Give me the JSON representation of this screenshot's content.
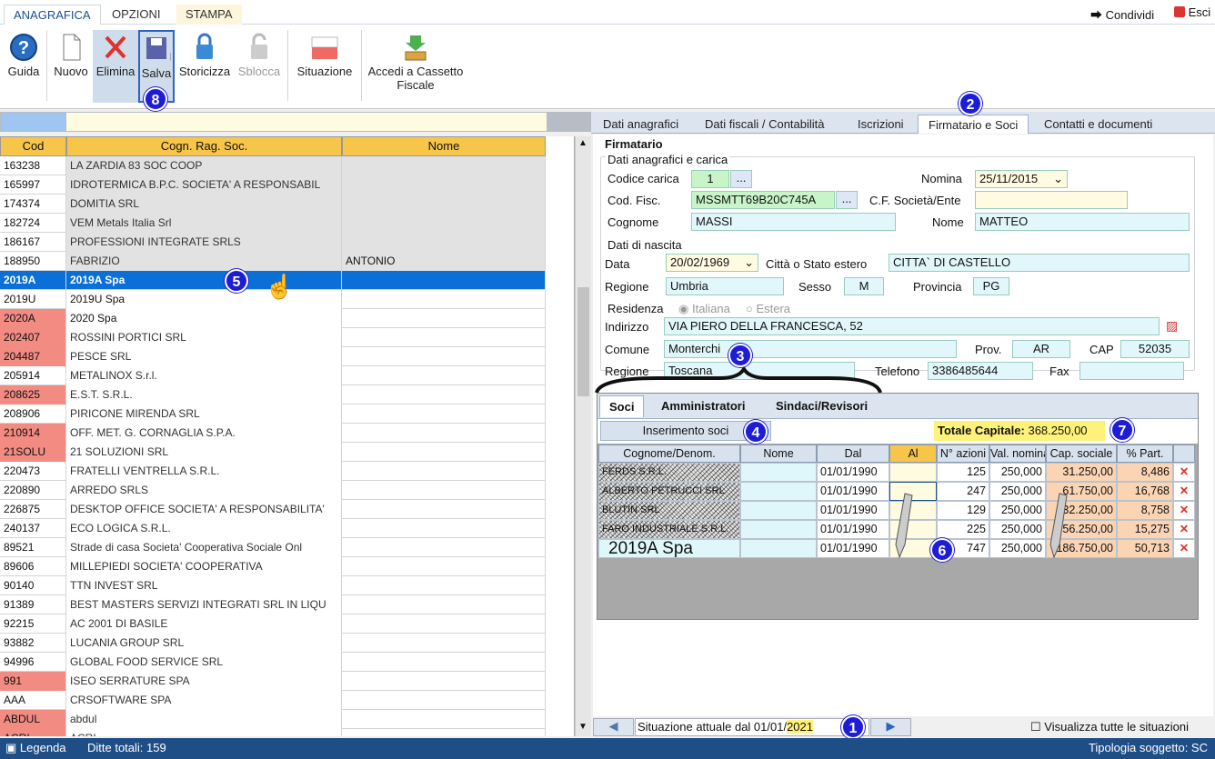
{
  "ribbon": {
    "tabs": [
      "ANAGRAFICA",
      "OPZIONI",
      "STAMPA"
    ],
    "share": "Condividi",
    "exit": "Esci"
  },
  "toolbar": {
    "guida": "Guida",
    "nuovo": "Nuovo",
    "elimina": "Elimina",
    "salva": "Salva",
    "storicizza": "Storicizza",
    "sblocca": "Sblocca",
    "situazione": "Situazione",
    "cassetto": "Accedi a Cassetto Fiscale"
  },
  "callouts": {
    "c1": "1",
    "c2": "2",
    "c3": "3",
    "c4": "4",
    "c5": "5",
    "c6": "6",
    "c7": "7",
    "c8": "8"
  },
  "grid": {
    "headers": {
      "cod": "Cod",
      "rag": "Cogn. Rag. Soc.",
      "nome": "Nome"
    },
    "rows": [
      {
        "cod": "163238",
        "rag": "LA ZARDIA 83 SOC COOP",
        "nome": "",
        "red": false
      },
      {
        "cod": "165997",
        "rag": "IDROTERMICA B.P.C. SOCIETA' A RESPONSABIL",
        "nome": "",
        "red": false
      },
      {
        "cod": "174374",
        "rag": "DOMITIA SRL",
        "nome": "",
        "red": false
      },
      {
        "cod": "182724",
        "rag": "VEM Metals Italia Srl",
        "nome": "",
        "red": false
      },
      {
        "cod": "186167",
        "rag": "PROFESSIONI INTEGRATE SRLS",
        "nome": "",
        "red": false
      },
      {
        "cod": "188950",
        "rag": "FABRIZIO",
        "nome": "ANTONIO",
        "red": false
      },
      {
        "cod": "2019A",
        "rag": "2019A Spa",
        "nome": "",
        "red": false,
        "selected": true
      },
      {
        "cod": "2019U",
        "rag": "2019U Spa",
        "nome": "",
        "red": false
      },
      {
        "cod": "2020A",
        "rag": "2020 Spa",
        "nome": "",
        "red": true
      },
      {
        "cod": "202407",
        "rag": "ROSSINI PORTICI SRL",
        "nome": "",
        "red": true
      },
      {
        "cod": "204487",
        "rag": "PESCE SRL",
        "nome": "",
        "red": true
      },
      {
        "cod": "205914",
        "rag": "METALINOX S.r.l.",
        "nome": "",
        "red": false
      },
      {
        "cod": "208625",
        "rag": "E.S.T. S.R.L.",
        "nome": "",
        "red": true
      },
      {
        "cod": "208906",
        "rag": "PIRICONE MIRENDA SRL",
        "nome": "",
        "red": false
      },
      {
        "cod": "210914",
        "rag": "OFF. MET. G. CORNAGLIA S.P.A.",
        "nome": "",
        "red": true
      },
      {
        "cod": "21SOLU",
        "rag": "21 SOLUZIONI SRL",
        "nome": "",
        "red": true
      },
      {
        "cod": "220473",
        "rag": "FRATELLI VENTRELLA S.R.L.",
        "nome": "",
        "red": false
      },
      {
        "cod": "220890",
        "rag": "ARREDO SRLS",
        "nome": "",
        "red": false
      },
      {
        "cod": "226875",
        "rag": "DESKTOP OFFICE SOCIETA' A RESPONSABILITA'",
        "nome": "",
        "red": false
      },
      {
        "cod": "240137",
        "rag": "ECO LOGICA S.R.L.",
        "nome": "",
        "red": false
      },
      {
        "cod": "89521",
        "rag": "Strade di casa Societa' Cooperativa Sociale Onl",
        "nome": "",
        "red": false
      },
      {
        "cod": "89606",
        "rag": "MILLEPIEDI SOCIETA' COOPERATIVA",
        "nome": "",
        "red": false
      },
      {
        "cod": "90140",
        "rag": "TTN INVEST SRL",
        "nome": "",
        "red": false
      },
      {
        "cod": "91389",
        "rag": "BEST MASTERS SERVIZI INTEGRATI SRL IN LIQU",
        "nome": "",
        "red": false
      },
      {
        "cod": "92215",
        "rag": "AC 2001 DI BASILE",
        "nome": "",
        "red": false
      },
      {
        "cod": "93882",
        "rag": "LUCANIA GROUP SRL",
        "nome": "",
        "red": false
      },
      {
        "cod": "94996",
        "rag": "GLOBAL FOOD SERVICE SRL",
        "nome": "",
        "red": false
      },
      {
        "cod": "991",
        "rag": "ISEO SERRATURE SPA",
        "nome": "",
        "red": true
      },
      {
        "cod": "AAA",
        "rag": "CRSOFTWARE SPA",
        "nome": "",
        "red": false
      },
      {
        "cod": "ABDUL",
        "rag": "abdul",
        "nome": "",
        "red": true
      },
      {
        "cod": "ACRI",
        "rag": "ACRI",
        "nome": "",
        "red": true
      }
    ]
  },
  "right_tabs": [
    "Dati anagrafici",
    "Dati fiscali / Contabilità",
    "Iscrizioni",
    "Firmatario e Soci",
    "Contatti e documenti"
  ],
  "firmatario": {
    "title": "Firmatario",
    "grp1": "Dati anagrafici e carica",
    "codice_carica_label": "Codice carica",
    "codice_carica": "1",
    "nomina_label": "Nomina",
    "nomina": "25/11/2015",
    "cf_label": "Cod. Fisc.",
    "cf": "MSSMTT69B20C745A",
    "cf_soc_label": "C.F. Società/Ente",
    "cf_soc": "",
    "cognome_label": "Cognome",
    "cognome": "MASSI",
    "nome_label": "Nome",
    "nome": "MATTEO",
    "grp2": "Dati di nascita",
    "data_label": "Data",
    "data": "20/02/1969",
    "citta_label": "Città o Stato estero",
    "citta": "CITTA` DI CASTELLO",
    "regione_label": "Regione",
    "regione": "Umbria",
    "sesso_label": "Sesso",
    "sesso": "M",
    "provincia_label": "Provincia",
    "provincia": "PG",
    "grp3": "Residenza",
    "italiana": "Italiana",
    "estera": "Estera",
    "indirizzo_label": "Indirizzo",
    "indirizzo": "VIA PIERO DELLA FRANCESCA, 52",
    "comune_label": "Comune",
    "comune": "Monterchi",
    "prov_label": "Prov.",
    "prov": "AR",
    "cap_label": "CAP",
    "cap": "52035",
    "regione2_label": "Regione",
    "regione2": "Toscana",
    "telefono_label": "Telefono",
    "telefono": "3386485644",
    "fax_label": "Fax",
    "fax": "",
    "dots": "..."
  },
  "soci": {
    "tabs": [
      "Soci",
      "Amministratori",
      "Sindaci/Revisori"
    ],
    "insert_button": "Inserimento soci",
    "totale_label": "Totale Capitale:",
    "totale": "368.250,00",
    "headers": [
      "Cognome/Denom.",
      "Nome",
      "Dal",
      "Al",
      "N° azioni",
      "Val. nominale",
      "Cap. sociale",
      "% Part."
    ],
    "rows": [
      {
        "cogn": "FERDS S.R.L.",
        "nome": "",
        "dal": "01/01/1990",
        "al": "",
        "az": "125",
        "val": "250,000",
        "cap": "31.250,00",
        "pct": "8,486"
      },
      {
        "cogn": "ALBERTO PETRUCCI SRL",
        "nome": "",
        "dal": "01/01/1990",
        "al": "",
        "az": "247",
        "val": "250,000",
        "cap": "61.750,00",
        "pct": "16,768"
      },
      {
        "cogn": "BLUTIN SRL",
        "nome": "",
        "dal": "01/01/1990",
        "al": "",
        "az": "129",
        "val": "250,000",
        "cap": "32.250,00",
        "pct": "8,758"
      },
      {
        "cogn": "FARO INDUSTRIALE S.R.L.",
        "nome": "",
        "dal": "01/01/1990",
        "al": "",
        "az": "225",
        "val": "250,000",
        "cap": "56.250,00",
        "pct": "15,275"
      },
      {
        "cogn": "2019A Spa",
        "nome": "",
        "dal": "01/01/1990",
        "al": "",
        "az": "747",
        "val": "250,000",
        "cap": "186.750,00",
        "pct": "50,713"
      }
    ]
  },
  "situazione": {
    "text": "Situazione attuale dal 01/01/",
    "year": "2021",
    "checkbox": "Visualizza tutte le situazioni"
  },
  "status": {
    "legenda": "Legenda",
    "ditte": "Ditte totali: 159",
    "tipologia": "Tipologia soggetto: SC"
  },
  "colors": {
    "accent": "#1f4e86",
    "header": "#f7c54a",
    "selected": "#0a6fd6",
    "red": "#f28b82",
    "field": "#e2f7fb"
  }
}
